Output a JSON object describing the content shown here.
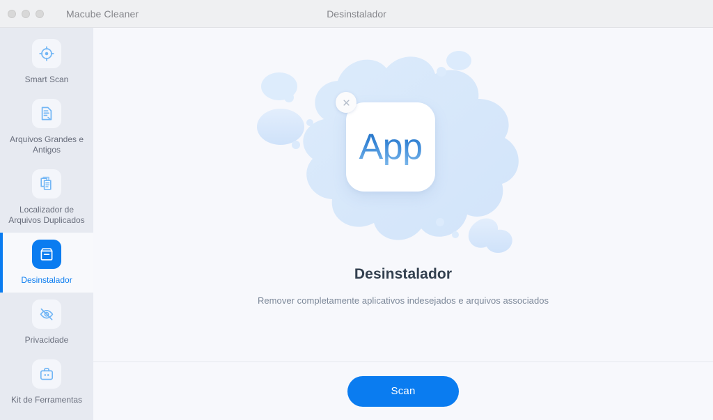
{
  "titlebar": {
    "app_title": "Macube Cleaner",
    "center_title": "Desinstalador",
    "traffic_lights": [
      "close",
      "minimize",
      "zoom"
    ]
  },
  "sidebar": {
    "items": [
      {
        "id": "smart-scan",
        "label": "Smart Scan",
        "icon": "target-icon",
        "active": false
      },
      {
        "id": "large-old-files",
        "label": "Arquivos Grandes e Antigos",
        "icon": "document-icon",
        "active": false
      },
      {
        "id": "duplicate-finder",
        "label": "Localizador de Arquivos Duplicados",
        "icon": "duplicate-files-icon",
        "active": false
      },
      {
        "id": "uninstaller",
        "label": "Desinstalador",
        "icon": "archive-box-icon",
        "active": true
      },
      {
        "id": "privacy",
        "label": "Privacidade",
        "icon": "eye-off-icon",
        "active": false
      },
      {
        "id": "toolkit",
        "label": "Kit de Ferramentas",
        "icon": "toolbox-icon",
        "active": false
      }
    ]
  },
  "main": {
    "illustration": {
      "app_tile_label": "App",
      "delete_badge_icon": "close-x-icon"
    },
    "heading": "Desinstalador",
    "subheading": "Remover completamente aplicativos indesejados e arquivos associados",
    "scan_button_label": "Scan"
  },
  "colors": {
    "accent": "#0a7cf0",
    "sidebar_bg": "#e7eaf1",
    "main_bg": "#f7f8fc",
    "titlebar_bg": "#eff0f2",
    "icon_blue": "#72b6f5",
    "label_gray": "#6a6f7d"
  }
}
